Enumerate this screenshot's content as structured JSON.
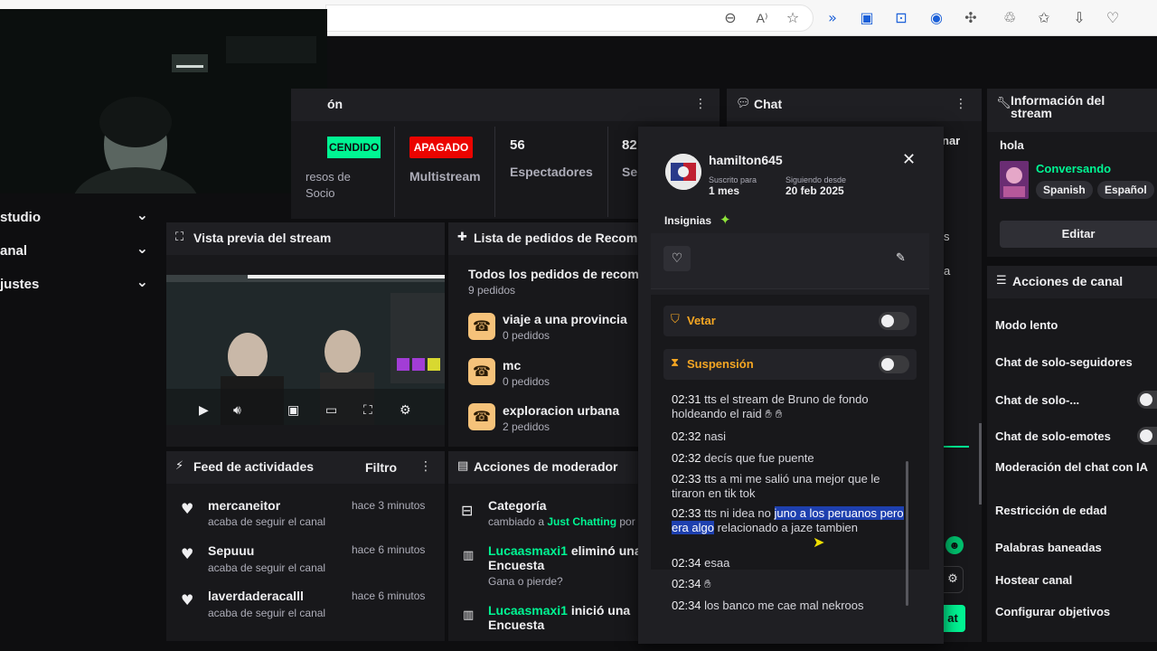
{
  "browser": {
    "icons": [
      "zoom-icon",
      "read-aloud-icon",
      "favorite-star-icon",
      "extension-a-icon",
      "extension-b-icon",
      "extension-c-icon",
      "extension-d-icon",
      "extensions-icon",
      "performance-icon",
      "favorites-icon",
      "downloads-icon",
      "heart-monitor-icon"
    ]
  },
  "nav": {
    "items": [
      {
        "label": "studio"
      },
      {
        "label": "anal"
      },
      {
        "label": "justes"
      }
    ]
  },
  "stats": {
    "section_title": "ón",
    "badge_on": "CENDIDO",
    "on_caption": "resos de\nSocio",
    "badge_off": "APAGADO",
    "off_caption": "Multistream",
    "viewers_value": "56",
    "viewers_caption": "Espectadores",
    "followers_value": "82",
    "followers_caption": "Se"
  },
  "preview": {
    "title": "Vista previa del stream"
  },
  "requests": {
    "title": "Lista de pedidos de Recom",
    "all_title": "Todos los pedidos de recom",
    "all_count": "9 pedidos",
    "items": [
      {
        "name": "viaje a una provincia",
        "count": "0 pedidos"
      },
      {
        "name": "mc",
        "count": "0 pedidos"
      },
      {
        "name": "exploracion urbana",
        "count": "2 pedidos"
      }
    ]
  },
  "feed": {
    "title": "Feed de actividades",
    "filter": "Filtro",
    "items": [
      {
        "user": "mercaneitor",
        "action": "acaba de seguir el canal",
        "time": "hace 3 minutos"
      },
      {
        "user": "Sepuuu",
        "action": "acaba de seguir el canal",
        "time": "hace 6 minutos"
      },
      {
        "user": "laverdaderacalll",
        "action": "acaba de seguir el canal",
        "time": "hace 6 minutos"
      }
    ]
  },
  "modactions": {
    "title": "Acciones de moderador",
    "category_title": "Categoría",
    "category_prefix": "cambiado a ",
    "category_game": "Just Chatting",
    "category_suffix": " por",
    "item2_user": "Lucaasmaxi1",
    "item2_action": " eliminó una",
    "item2_line2": "Encuesta",
    "item2_sub": "Gana o pierde?",
    "item3_user": "Lucaasmaxi1",
    "item3_action": " inició una",
    "item3_line2": "Encuesta"
  },
  "chat": {
    "title": "Chat",
    "side_text_1": "nar",
    "side_text_2": "s",
    "side_text_3": "a",
    "send_label": "at"
  },
  "usercard": {
    "username": "hamilton645",
    "sub_label": "Suscrito para",
    "sub_value": "1 mes",
    "follow_label": "Siguiendo desde",
    "follow_value": "20 feb 2025",
    "badges_label": "Insignias",
    "ban_label": "Vetar",
    "timeout_label": "Suspensión",
    "messages": [
      {
        "time": "02:31",
        "text": "tts el stream de Bruno de fondo holdeando el raid"
      },
      {
        "time": "02:32",
        "text": "nasi"
      },
      {
        "time": "02:32",
        "text": "decís que fue puente"
      },
      {
        "time": "02:33",
        "text": "tts a mi me salió una mejor que le tiraron en tik tok"
      },
      {
        "time": "02:33",
        "text_pre": "tts ni idea no ",
        "text_hl": "juno a los peruanos pero era algo",
        "text_post": " relacionado a jaze tambien"
      },
      {
        "time": "02:34",
        "text": "esaa"
      },
      {
        "time": "02:34",
        "text": ""
      },
      {
        "time": "02:34",
        "text": "los banco me cae mal nekroos"
      }
    ]
  },
  "streaminfo": {
    "title": "Información del stream",
    "stream_title": "hola",
    "category": "Conversando",
    "tags": [
      "Spanish",
      "Español"
    ],
    "edit": "Editar"
  },
  "channelactions": {
    "title": "Acciones de canal",
    "items": [
      "Modo lento",
      "Chat de solo-seguidores",
      "Chat de solo-...",
      "Chat de solo-emotes",
      "Moderación del chat con IA",
      "Restricción de edad",
      "Palabras baneadas",
      "Hostear canal",
      "Configurar objetivos"
    ]
  },
  "colors": {
    "accent_green": "#00f593",
    "badge_off": "#eb0400",
    "highlight": "#1e40af"
  }
}
